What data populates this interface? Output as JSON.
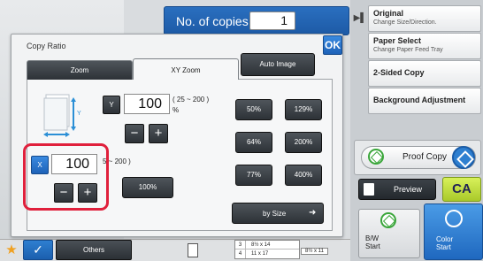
{
  "header": {
    "copies_label": "No. of copies",
    "copies_value": "1"
  },
  "right_panel": {
    "items": [
      {
        "title": "Original",
        "sub": "Change Size/Direction."
      },
      {
        "title": "Paper Select",
        "sub": "Change Paper Feed Tray"
      },
      {
        "title": "2-Sided Copy",
        "sub": ""
      },
      {
        "title": "Background Adjustment",
        "sub": ""
      }
    ],
    "proof_copy_label": "Proof Copy",
    "preview_label": "Preview",
    "ca_label": "CA",
    "bw_label": "B/W",
    "bw_start": "Start",
    "color_label": "Color",
    "color_start": "Start"
  },
  "dialog": {
    "title": "Copy Ratio",
    "ok_label": "OK",
    "tabs": [
      {
        "label": "Zoom"
      },
      {
        "label": "XY Zoom"
      }
    ],
    "auto_image_label": "Auto Image",
    "y": {
      "axis_label": "Y",
      "value": "100",
      "range": "( 25 ~ 200 )",
      "unit": "%"
    },
    "x": {
      "axis_label": "X",
      "value": "100",
      "range": "5 ~ 200 )"
    },
    "minus_glyph": "−",
    "plus_glyph": "+",
    "reset_label": "100%",
    "presets": [
      "50%",
      "129%",
      "64%",
      "200%",
      "77%",
      "400%"
    ],
    "by_size_label": "by Size"
  },
  "bottom_bar": {
    "others_label": "Others",
    "trays": [
      {
        "num": "3",
        "size": "8½ x 14"
      },
      {
        "num": "4",
        "size": "11 x 17"
      }
    ],
    "extra_size": "8½ x 11"
  },
  "colors": {
    "highlight": "#e0203c",
    "accent_blue": "#1e62b8",
    "ca_green": "#b9d93a"
  }
}
